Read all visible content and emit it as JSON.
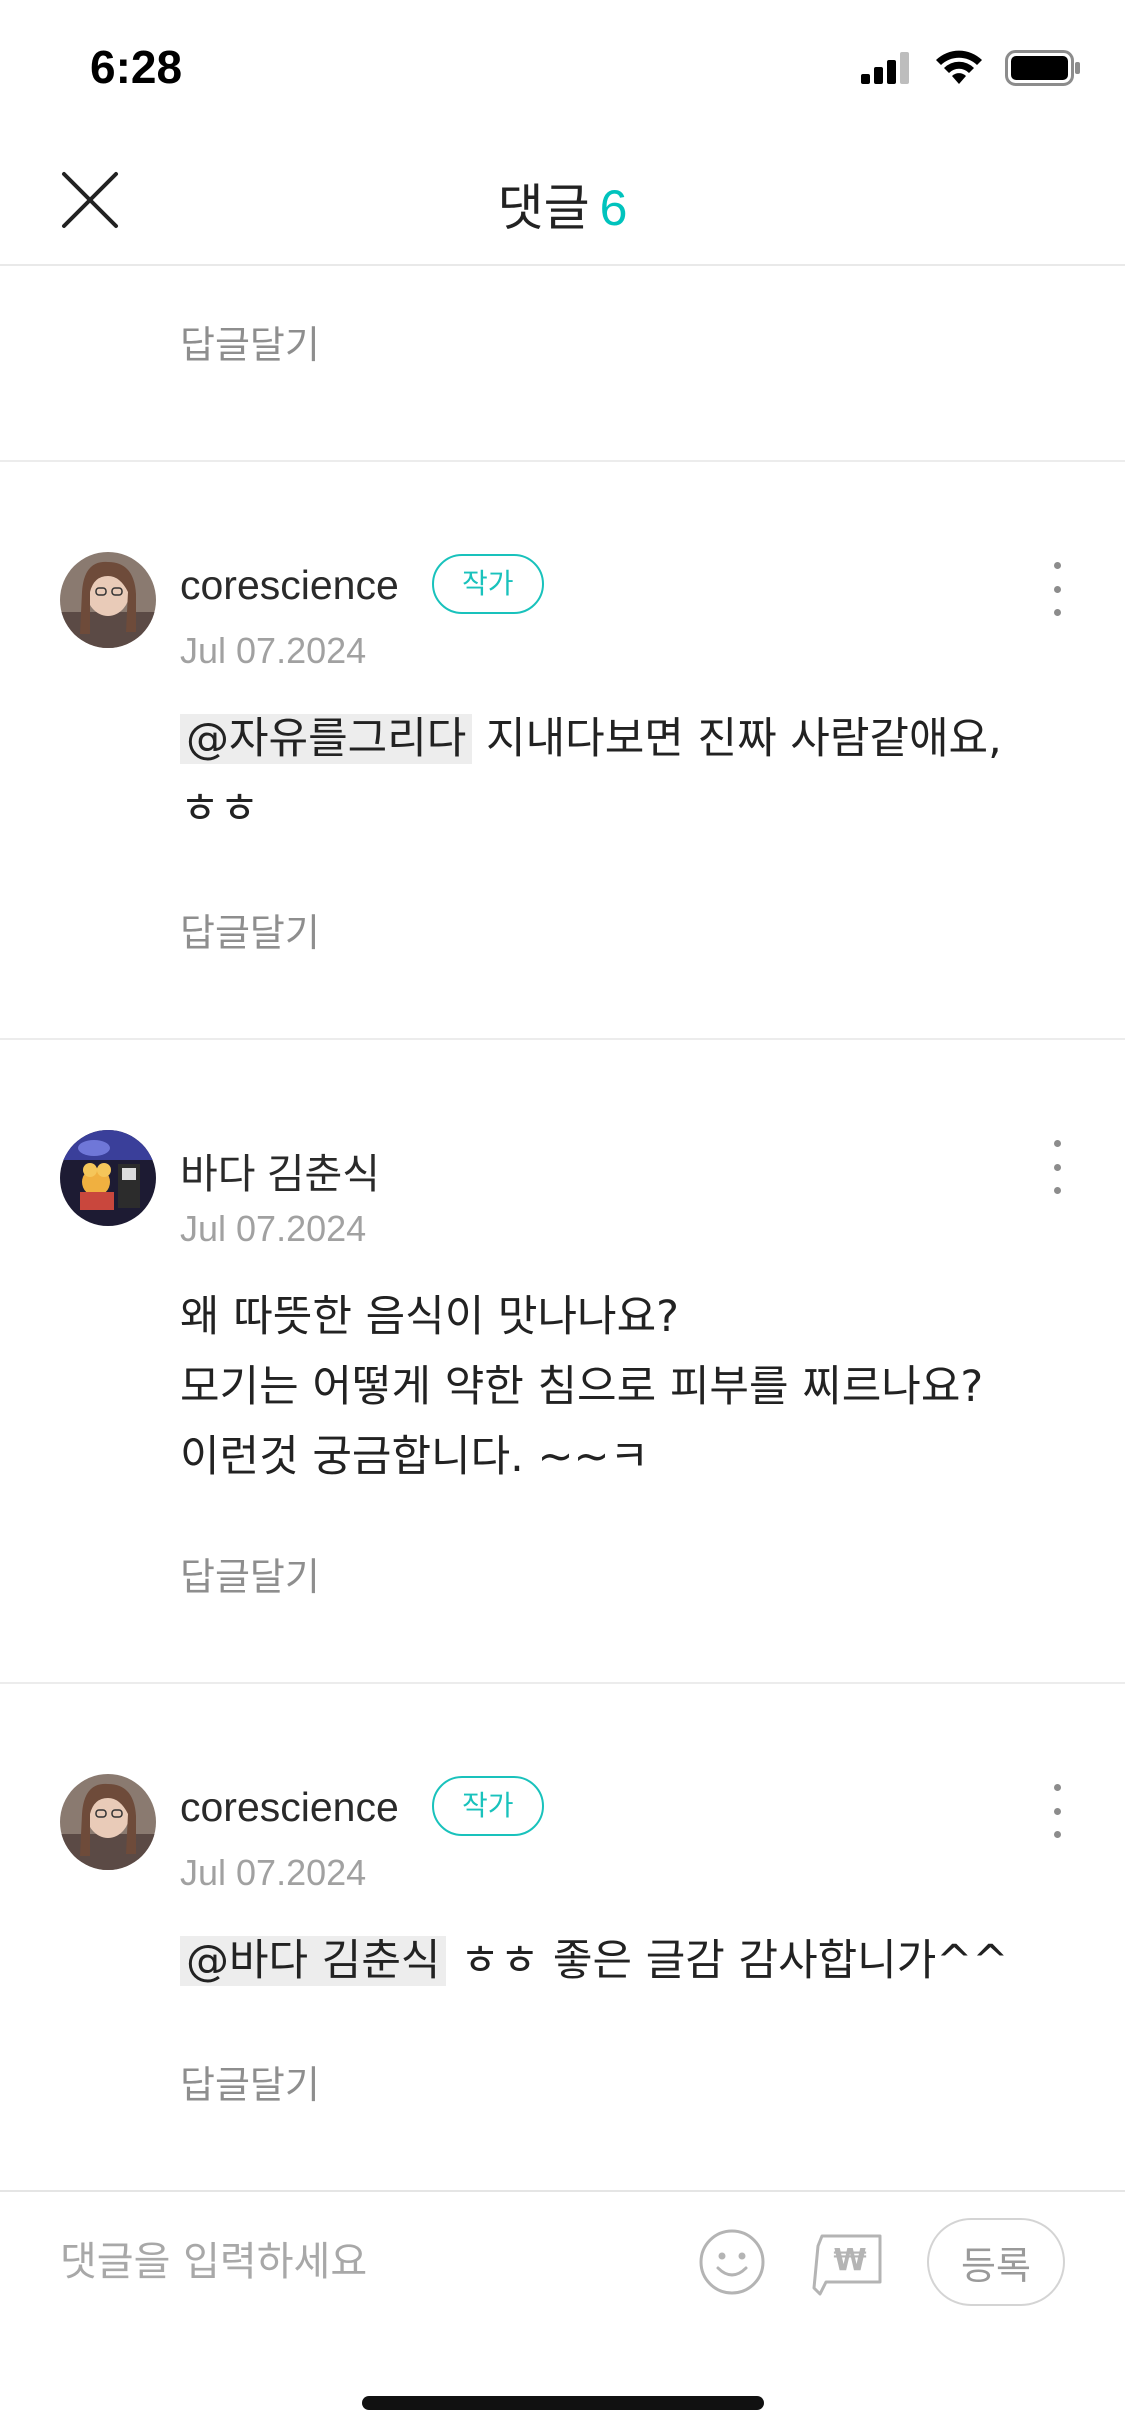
{
  "status_bar": {
    "time": "6:28"
  },
  "header": {
    "title": "댓글",
    "count": "6"
  },
  "top_reply_label": "답글달기",
  "comments": [
    {
      "author": "corescience",
      "badge": "작가",
      "date": "Jul 07.2024",
      "mention": "@자유를그리다",
      "text": "지내다보면 진짜 사람같애요, ㅎㅎ",
      "reply_label": "답글달기"
    },
    {
      "author": "바다 김춘식",
      "date": "Jul 07.2024",
      "lines": [
        "왜 따뜻한 음식이 맛나나요?",
        "모기는 어떻게 약한 침으로 피부를 찌르나요?",
        "이런것 궁금합니다. ~~ㅋ"
      ],
      "reply_label": "답글달기"
    },
    {
      "author": "corescience",
      "badge": "작가",
      "date": "Jul 07.2024",
      "mention": "@바다 김춘식",
      "text": "ㅎㅎ 좋은 글감 감사합니가^^",
      "reply_label": "답글달기"
    }
  ],
  "input": {
    "placeholder": "댓글을 입력하세요",
    "submit_label": "등록"
  },
  "icons": {
    "close": "close-icon",
    "more": "more-vertical-icon",
    "emoji": "smiley-icon",
    "donate": "won-coin-icon"
  },
  "colors": {
    "accent": "#00c3bd",
    "muted": "#8e8e8e",
    "mention_bg": "#ededed"
  }
}
